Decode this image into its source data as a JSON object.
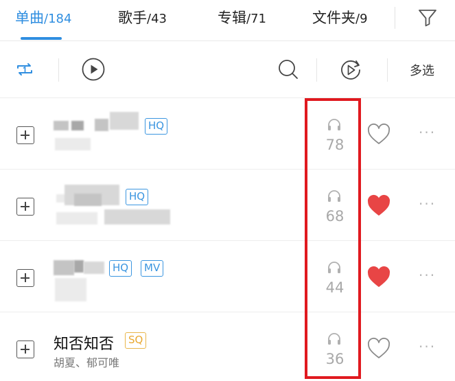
{
  "tabs": [
    {
      "label": "单曲",
      "count": "/184",
      "active": true
    },
    {
      "label": "歌手",
      "count": "/43",
      "active": false
    },
    {
      "label": "专辑",
      "count": "/71",
      "active": false
    },
    {
      "label": "文件夹",
      "count": "/9",
      "active": false
    }
  ],
  "toolbar": {
    "multi_select_label": "多选"
  },
  "songs": [
    {
      "title": "",
      "artist": "",
      "badges": [
        "HQ"
      ],
      "play_count": "78",
      "liked": false
    },
    {
      "title": "",
      "artist": "",
      "badges": [
        "HQ"
      ],
      "play_count": "68",
      "liked": true
    },
    {
      "title": "",
      "artist": "",
      "badges": [
        "HQ",
        "MV"
      ],
      "play_count": "44",
      "liked": true
    },
    {
      "title": "知否知否",
      "artist": "胡夏、郁可唯",
      "badges": [
        "SQ"
      ],
      "play_count": "36",
      "liked": false
    }
  ],
  "colors": {
    "accent": "#2f8ee0",
    "liked_heart": "#e84545",
    "sq_badge": "#e9a830",
    "highlight": "#e0191f"
  },
  "icons": [
    "loop-one-icon",
    "play-all-icon",
    "search-icon",
    "shuffle-play-icon",
    "filter-icon",
    "headphones-icon",
    "heart-icon",
    "more-icon",
    "add-icon"
  ]
}
